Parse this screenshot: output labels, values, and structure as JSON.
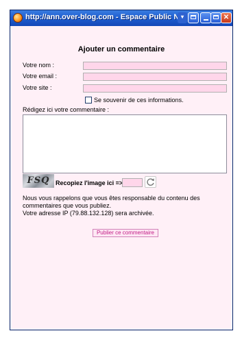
{
  "window": {
    "title": "http://ann.over-blog.com - Espace Public Numér",
    "controls": {
      "dropdown": "▾",
      "close": "✕"
    }
  },
  "form": {
    "heading": "Ajouter un commentaire",
    "name_label": "Votre nom :",
    "name_value": "",
    "email_label": "Votre email :",
    "email_value": "",
    "site_label": "Votre site :",
    "site_value": "",
    "remember_label": "Se souvenir de ces informations.",
    "remember_checked": false,
    "comment_label": "Rédigez ici votre commentaire :",
    "comment_value": "",
    "captcha_image_text": "FSQ",
    "captcha_label": "Recopiez l'image ici =>",
    "captcha_value": "",
    "notice_lines": [
      "Nous vous rappelons que vous êtes responsable du contenu des",
      "commentaires que vous publiez.",
      "Votre adresse IP (79.88.132.128) sera archivée."
    ],
    "submit_label": "Publier ce commentaire"
  },
  "colors": {
    "titlebar": "#1f5fd1",
    "page_background": "#fff0f7",
    "field_background": "#ffd6ea",
    "submit_text": "#c02088"
  },
  "icons": {
    "browser": "firefox-icon",
    "refresh": "refresh-icon"
  }
}
